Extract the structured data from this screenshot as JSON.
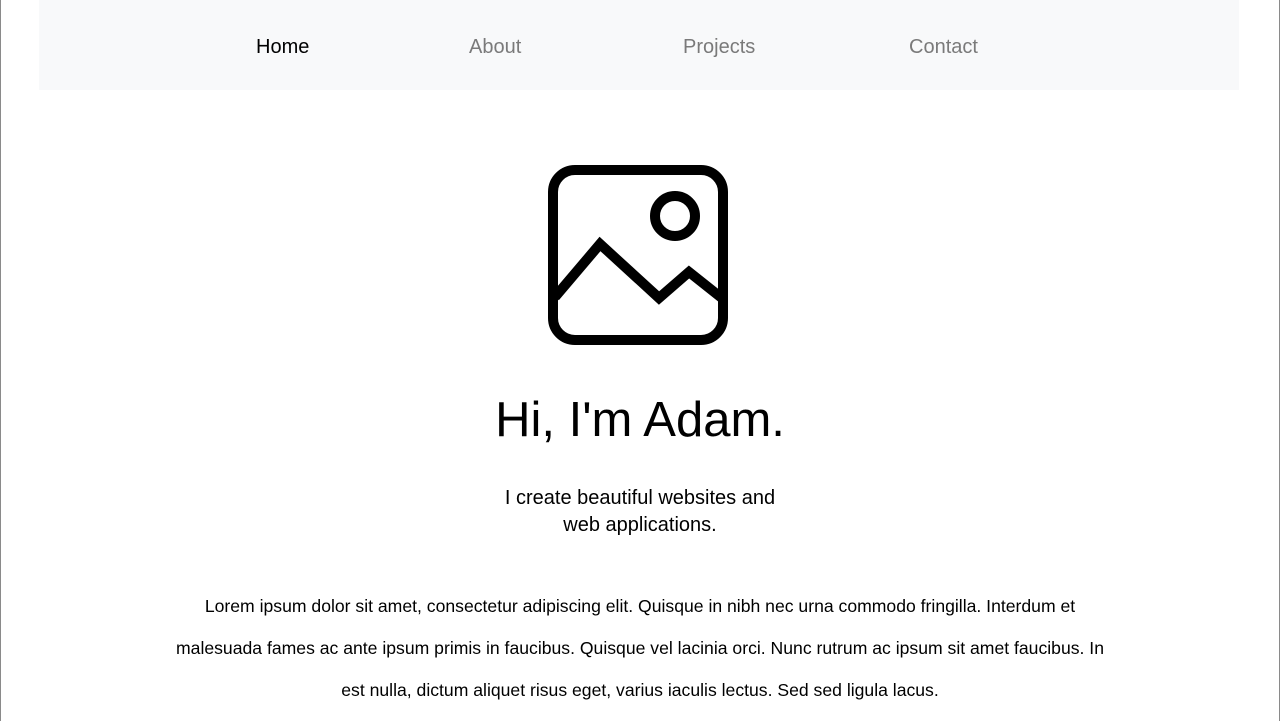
{
  "nav": {
    "items": [
      {
        "label": "Home",
        "active": true
      },
      {
        "label": "About",
        "active": false
      },
      {
        "label": "Projects",
        "active": false
      },
      {
        "label": "Contact",
        "active": false
      }
    ]
  },
  "hero": {
    "image_icon": "image-placeholder-icon",
    "title": "Hi, I'm Adam.",
    "subtitle": "I create beautiful websites and web applications.",
    "body": "Lorem ipsum dolor sit amet, consectetur adipiscing elit. Quisque in nibh nec urna commodo fringilla. Interdum et malesuada fames ac ante ipsum primis in faucibus. Quisque vel lacinia orci. Nunc rutrum ac ipsum sit amet faucibus. In est nulla, dictum aliquet risus eget, varius iaculis lectus. Sed sed ligula lacus."
  },
  "colors": {
    "nav_background": "#f8f9fa",
    "nav_active": "#000000",
    "nav_inactive": "#7a7a7a",
    "text": "#000000"
  }
}
